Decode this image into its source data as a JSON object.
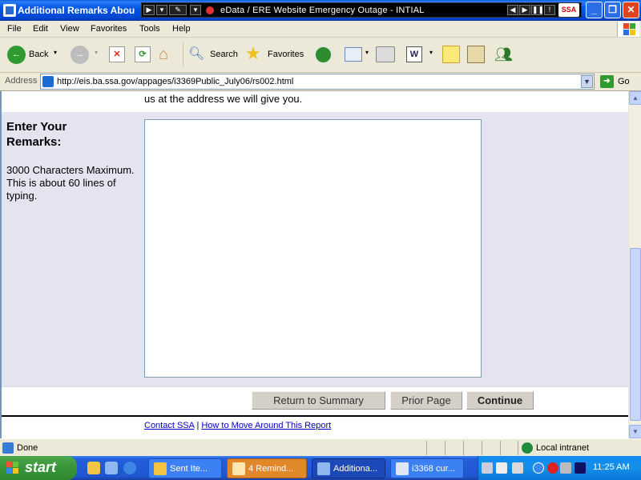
{
  "window": {
    "title": "Additional Remarks Abou",
    "media_bar_text": "eData / ERE Website Emergency Outage - INTIAL",
    "ssa_badge": "SSA"
  },
  "menu": [
    "File",
    "Edit",
    "View",
    "Favorites",
    "Tools",
    "Help"
  ],
  "toolbar": {
    "back_label": "Back",
    "search_label": "Search",
    "favorites_label": "Favorites"
  },
  "address_bar": {
    "label": "Address",
    "url": "http://eis.ba.ssa.gov/appages/i3369Public_July06/rs002.html",
    "go_label": "Go"
  },
  "page": {
    "top_text": "us at the address we will give you.",
    "remarks_heading": "Enter Your Remarks:",
    "remarks_hint": "3000 Characters Maximum. This is about 60 lines of typing.",
    "remarks_value": "",
    "buttons": {
      "return_summary": "Return to Summary",
      "prior_page": "Prior Page",
      "continue": "Continue"
    },
    "footer": {
      "contact_link": "Contact SSA",
      "separator": "|",
      "help_link": "How to Move Around This Report"
    }
  },
  "status_bar": {
    "status": "Done",
    "zone": "Local intranet"
  },
  "taskbar": {
    "start_label": "start",
    "tasks": [
      {
        "label": "Sent Ite..."
      },
      {
        "label": "4 Remind..."
      },
      {
        "label": "Additiona..."
      },
      {
        "label": "i3368 cur..."
      }
    ],
    "clock": "11:25 AM"
  },
  "colors": {
    "titlebar": "#0055e5",
    "remarks_panel": "#e4e4f1",
    "button_face": "#d4d0c8",
    "link": "#0000cc",
    "taskbar": "#245edb",
    "start_button": "#3a953a"
  }
}
